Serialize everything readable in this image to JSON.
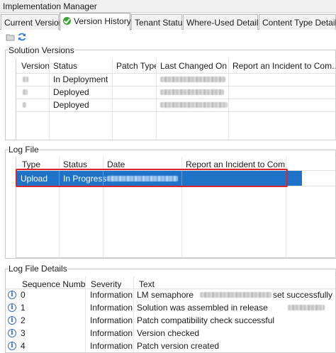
{
  "window": {
    "title": "Implementation Manager"
  },
  "tabs": [
    {
      "label": "Current Version"
    },
    {
      "label": "Version History",
      "active": true,
      "icon": "check-circle-icon"
    },
    {
      "label": "Tenant Status"
    },
    {
      "label": "Where-Used Details"
    },
    {
      "label": "Content Type Details"
    }
  ],
  "toolbar": {
    "icons": [
      "folder-icon",
      "refresh-icon"
    ]
  },
  "solution_versions": {
    "title": "Solution Versions",
    "columns": [
      "Version",
      "Status",
      "Patch Type",
      "Last Changed On",
      "Report an Incident to Com..."
    ],
    "rows": [
      {
        "status": "In Deployment"
      },
      {
        "status": "Deployed"
      },
      {
        "status": "Deployed"
      }
    ]
  },
  "log_file": {
    "title": "Log File",
    "columns": [
      "Type",
      "Status",
      "Date",
      "Report an Incident to Com..."
    ],
    "rows": [
      {
        "type": "Upload",
        "status": "In Progress"
      }
    ]
  },
  "log_file_details": {
    "title": "Log File Details",
    "columns": [
      "Sequence Number",
      "Severity",
      "Text"
    ],
    "rows": [
      {
        "seq": "0",
        "severity": "Information",
        "text_a": "LM semaphore",
        "text_b": "set successfully"
      },
      {
        "seq": "1",
        "severity": "Information",
        "text_a": "Solution was assembled in release"
      },
      {
        "seq": "2",
        "severity": "Information",
        "text_a": "Patch compatibility check successful"
      },
      {
        "seq": "3",
        "severity": "Information",
        "text_a": "Version checked"
      },
      {
        "seq": "4",
        "severity": "Information",
        "text_a": "Patch version created"
      }
    ]
  }
}
